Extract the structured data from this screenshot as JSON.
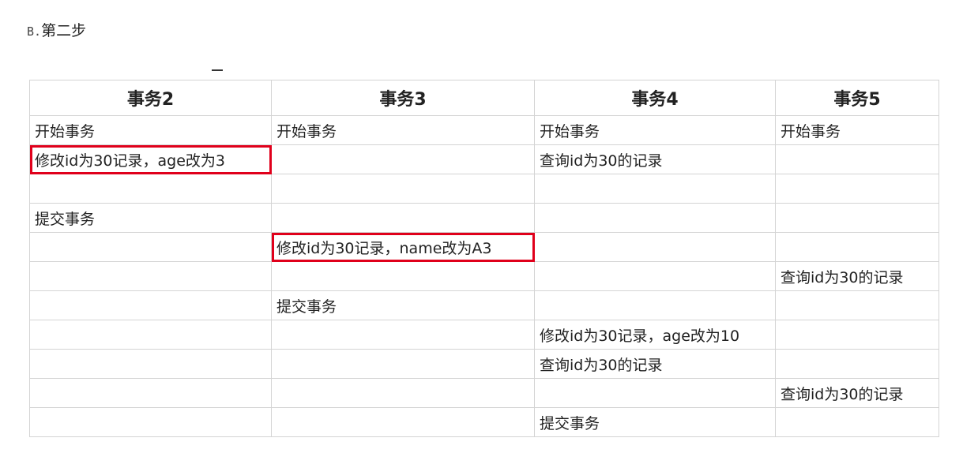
{
  "step": {
    "prefix": "B.",
    "title": "第二步"
  },
  "table": {
    "headers": [
      "事务2",
      "事务3",
      "事务4",
      "事务5"
    ],
    "rows": [
      [
        "开始事务",
        "开始事务",
        "开始事务",
        "开始事务"
      ],
      [
        "修改id为30记录，age改为3",
        "",
        "查询id为30的记录",
        ""
      ],
      [
        "",
        "",
        "",
        ""
      ],
      [
        "提交事务",
        "",
        "",
        ""
      ],
      [
        "",
        "修改id为30记录，name改为A3",
        "",
        ""
      ],
      [
        "",
        "",
        "",
        "查询id为30的记录"
      ],
      [
        "",
        "提交事务",
        "",
        ""
      ],
      [
        "",
        "",
        "修改id为30记录，age改为10",
        ""
      ],
      [
        "",
        "",
        "查询id为30的记录",
        ""
      ],
      [
        "",
        "",
        "",
        "查询id为30的记录"
      ],
      [
        "",
        "",
        "提交事务",
        ""
      ]
    ],
    "highlight_color": "#e0001b"
  }
}
